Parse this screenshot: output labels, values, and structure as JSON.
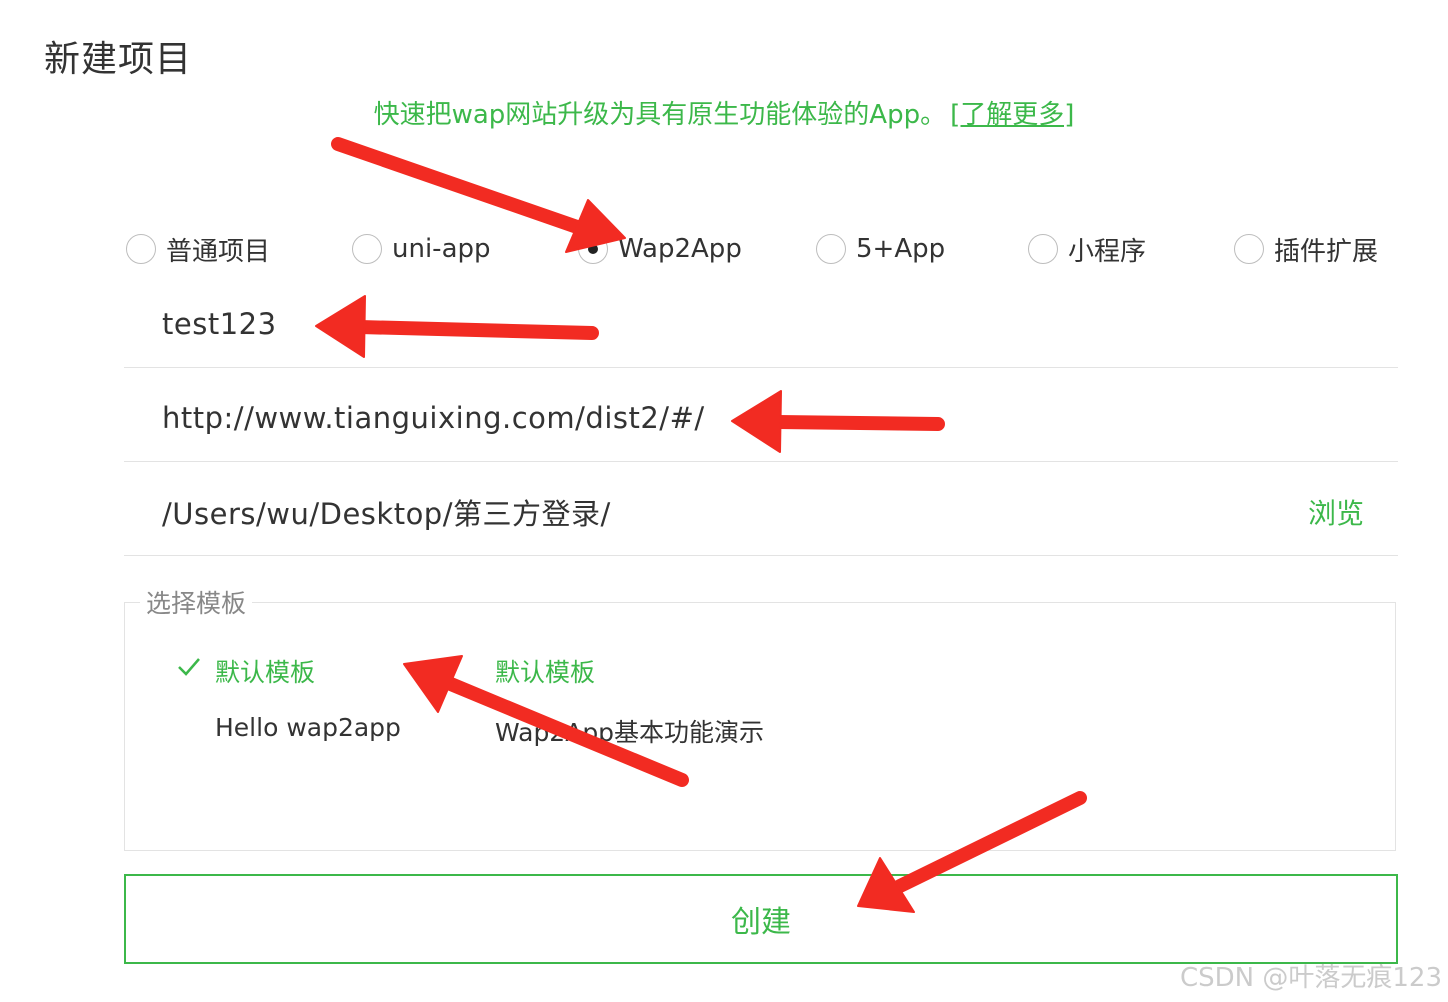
{
  "page": {
    "title": "新建项目",
    "banner_text": "快速把wap网站升级为具有原生功能体验的App。",
    "banner_link": "[了解更多]"
  },
  "project_types": [
    {
      "label": "普通项目",
      "selected": false
    },
    {
      "label": "uni-app",
      "selected": false
    },
    {
      "label": "Wap2App",
      "selected": true
    },
    {
      "label": "5+App",
      "selected": false
    },
    {
      "label": "小程序",
      "selected": false
    },
    {
      "label": "插件扩展",
      "selected": false
    }
  ],
  "form": {
    "project_name": "test123",
    "url": "http://www.tianguixing.com/dist2/#/",
    "location": "/Users/wu/Desktop/第三方登录/",
    "browse_label": "浏览"
  },
  "templates": {
    "legend": "选择模板",
    "items": [
      {
        "name": "默认模板",
        "description": "Hello wap2app",
        "selected": true
      },
      {
        "name": "默认模板",
        "description": "Wap2App基本功能演示",
        "selected": false
      }
    ]
  },
  "create_label": "创建",
  "watermark": "CSDN @叶落无痕123",
  "colors": {
    "accent": "#3cb84a",
    "annotation_arrow": "#f22b22"
  }
}
